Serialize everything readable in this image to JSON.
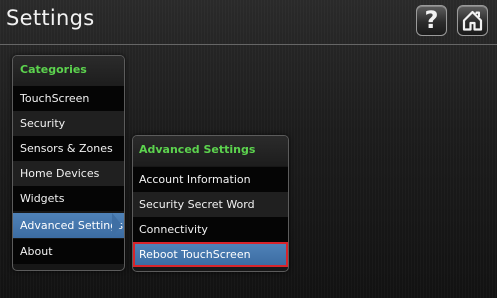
{
  "header": {
    "title": "Settings",
    "help_icon": "question-mark-icon",
    "help_glyph": "?",
    "home_icon": "home-icon"
  },
  "categories": {
    "title": "Categories",
    "items": [
      {
        "label": "TouchScreen"
      },
      {
        "label": "Security"
      },
      {
        "label": "Sensors & Zones"
      },
      {
        "label": "Home Devices"
      },
      {
        "label": "Widgets"
      },
      {
        "label": "Advanced Settings",
        "selected": true
      },
      {
        "label": "About"
      }
    ]
  },
  "advanced_settings": {
    "title": "Advanced Settings",
    "items": [
      {
        "label": "Account Information"
      },
      {
        "label": "Security Secret Word"
      },
      {
        "label": "Connectivity"
      },
      {
        "label": "Reboot TouchScreen",
        "selected": true,
        "highlighted": true
      }
    ]
  },
  "colors": {
    "header_text": "#5cd34e",
    "selected_item": "#3f6fa4",
    "highlight_border": "#d8242b"
  }
}
